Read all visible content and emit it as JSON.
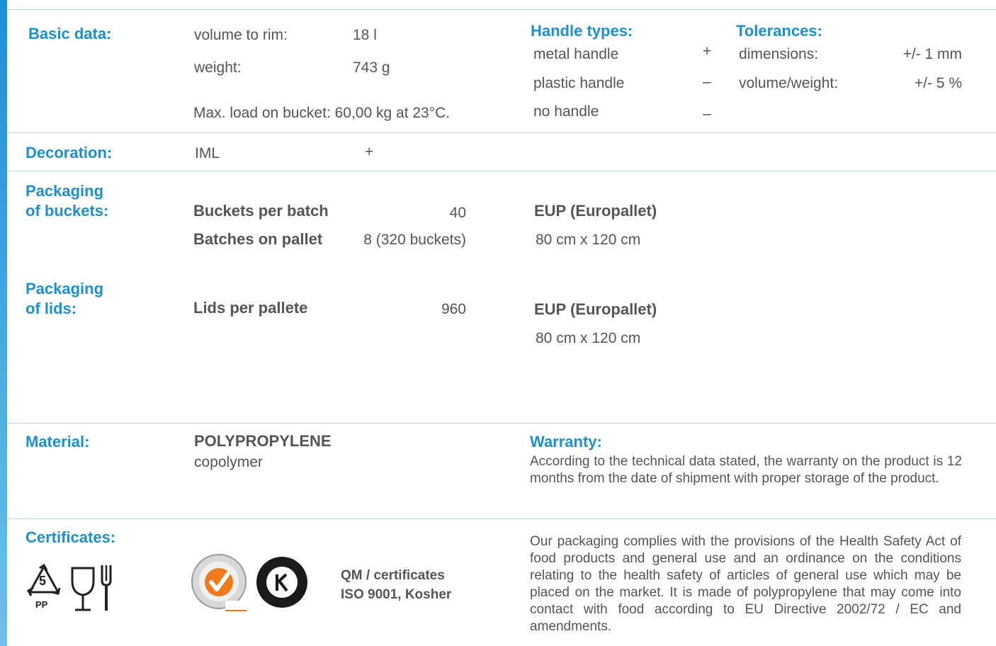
{
  "colors": {
    "accent": "#1e8fd0",
    "text": "#555555",
    "rule": "#b9d9ee"
  },
  "basic": {
    "label": "Basic data:",
    "volume_label": "volume to rim:",
    "volume_value": "18 l",
    "weight_label": "weight:",
    "weight_value": "743 g",
    "max_load": "Max. load on bucket: 60,00 kg at 23°C."
  },
  "handles": {
    "label": "Handle types:",
    "items": [
      {
        "name": "metal handle",
        "mark": "+"
      },
      {
        "name": "plastic handle",
        "mark": "–"
      },
      {
        "name": "no handle",
        "mark": "–"
      }
    ]
  },
  "tolerances": {
    "label": "Tolerances:",
    "items": [
      {
        "name": "dimensions:",
        "value": "+/- 1 mm"
      },
      {
        "name": "volume/weight:",
        "value": "+/- 5 %"
      }
    ]
  },
  "decoration": {
    "label": "Decoration:",
    "value": "IML",
    "mark": "+"
  },
  "pack_buckets": {
    "label_line1": "Packaging",
    "label_line2": "of buckets:",
    "per_batch_label": "Buckets per batch",
    "per_batch_value": "40",
    "batches_label": "Batches on pallet",
    "batches_value": "8 (320 buckets)",
    "pallet_title": "EUP (Europallet)",
    "pallet_size": "80 cm x 120 cm"
  },
  "pack_lids": {
    "label_line1": "Packaging",
    "label_line2": "of lids:",
    "per_pallet_label": "Lids per pallete",
    "per_pallet_value": "960",
    "pallet_title": "EUP (Europallet)",
    "pallet_size": "80 cm x 120 cm"
  },
  "material": {
    "label": "Material:",
    "name": "POLYPROPYLENE",
    "sub": "copolymer"
  },
  "warranty": {
    "label": "Warranty:",
    "text": "According to the technical data stated, the warranty on the product is 12 months from the date of shipment with proper storage of the product."
  },
  "certificates": {
    "label": "Certificates:",
    "recycle_number": "5",
    "recycle_code": "PP",
    "qm_line1": "QM / certificates",
    "qm_line2": "ISO 9001, Kosher",
    "compliance_text": "Our packaging complies with the provisions of the Health Safety Act of food products and general use and an ordinance on the conditions relating to the health safety of articles of general use which may be placed on the market. It is made of polypropylene that may come into contact with food according to EU Directive 2002/72 / EC and amendments.",
    "icons": [
      "recycle-pp-5-icon",
      "food-safe-glass-fork-icon",
      "iso-9001-sgs-seal-icon",
      "kosher-certified-seal-icon"
    ]
  }
}
